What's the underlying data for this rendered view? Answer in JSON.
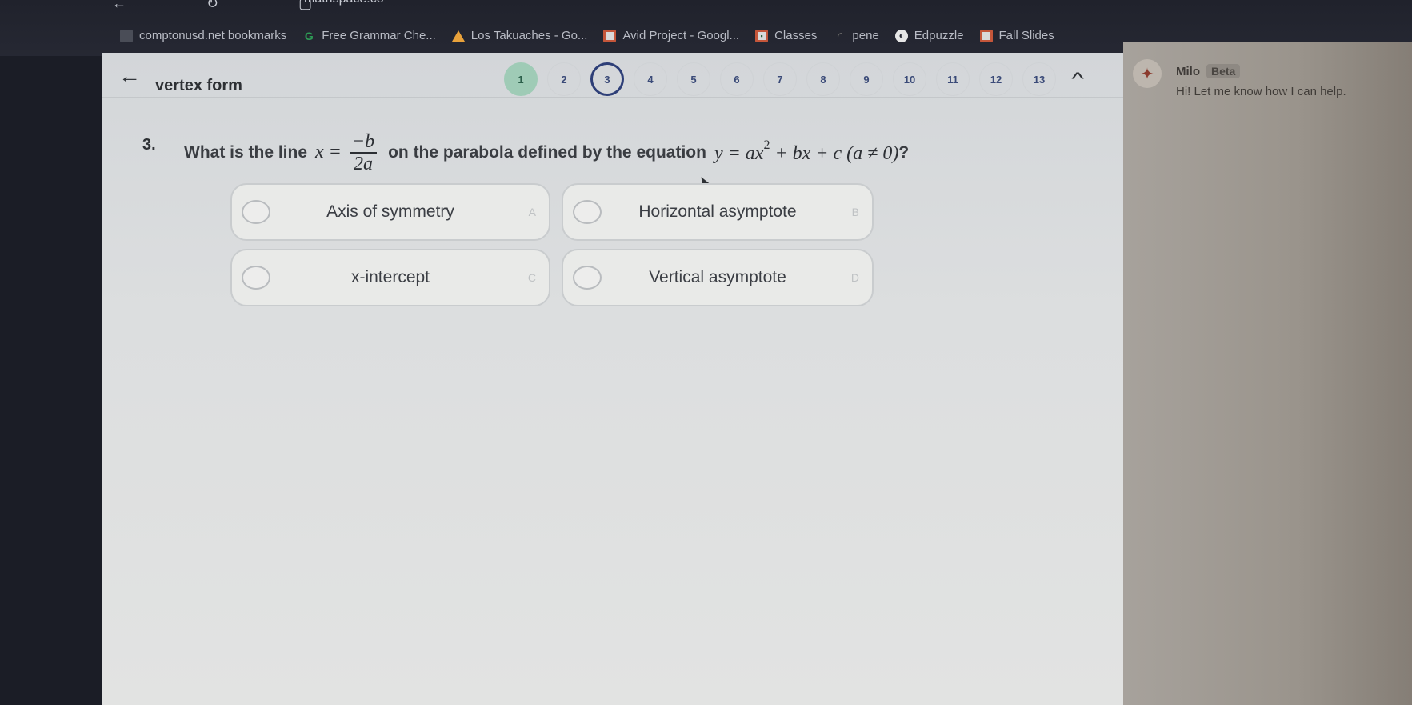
{
  "browser": {
    "url_partial": "mathspace.co",
    "bookmarks": [
      {
        "label": "comptonusd.net bookmarks",
        "icon": "folder-icon"
      },
      {
        "label": "Free Grammar Che...",
        "icon": "grammarly-icon"
      },
      {
        "label": "Los Takuaches - Go...",
        "icon": "google-drive-icon"
      },
      {
        "label": "Avid Project - Googl...",
        "icon": "google-slides-icon"
      },
      {
        "label": "Classes",
        "icon": "google-classroom-icon"
      },
      {
        "label": "pene",
        "icon": "loading-icon"
      },
      {
        "label": "Edpuzzle",
        "icon": "edpuzzle-icon"
      },
      {
        "label": "Fall Slides",
        "icon": "google-slides-icon"
      }
    ]
  },
  "header": {
    "back_icon": "arrow-left-icon",
    "title": "vertex form",
    "questions": [
      {
        "label": "1",
        "state": "done"
      },
      {
        "label": "2",
        "state": "pending"
      },
      {
        "label": "3",
        "state": "current"
      },
      {
        "label": "4",
        "state": "pending"
      },
      {
        "label": "5",
        "state": "pending"
      },
      {
        "label": "6",
        "state": "pending"
      },
      {
        "label": "7",
        "state": "pending"
      },
      {
        "label": "8",
        "state": "pending"
      },
      {
        "label": "9",
        "state": "pending"
      },
      {
        "label": "10",
        "state": "pending"
      },
      {
        "label": "11",
        "state": "pending"
      },
      {
        "label": "12",
        "state": "pending"
      },
      {
        "label": "13",
        "state": "pending"
      }
    ],
    "collapse_icon": "chevron-up-icon"
  },
  "question": {
    "number": "3.",
    "prefix": "What is the line",
    "formula_lhs": "x =",
    "frac_num": "−b",
    "frac_den": "2a",
    "middle": "on the parabola defined by the equation",
    "equation_main": "y = ax",
    "equation_exp": "2",
    "equation_rest": "+ bx + c (a ≠ 0)",
    "suffix": "?"
  },
  "choices": [
    {
      "letter": "A",
      "label": "Axis of symmetry"
    },
    {
      "letter": "B",
      "label": "Horizontal asymptote"
    },
    {
      "letter": "C",
      "label": "x-intercept"
    },
    {
      "letter": "D",
      "label": "Vertical asymptote"
    }
  ],
  "assistant": {
    "name": "Milo",
    "badge": "Beta",
    "message": "Hi! Let me know how I can help."
  }
}
